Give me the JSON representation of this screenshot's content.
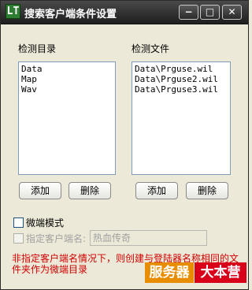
{
  "window": {
    "title": "搜索客户端条件设置",
    "icon_glyph": "LT",
    "minimize_glyph": "−",
    "maximize_glyph": "□",
    "close_glyph": "✕"
  },
  "dirs": {
    "label": "检测目录",
    "items": [
      "Data",
      "Map",
      "Wav"
    ],
    "add_label": "添加",
    "delete_label": "删除"
  },
  "files": {
    "label": "检测文件",
    "items": [
      "Data\\Prguse.wil",
      "Data\\Prguse2.wil",
      "Data\\Prguse3.wil"
    ],
    "add_label": "添加",
    "delete_label": "删除"
  },
  "options": {
    "micro_mode_label": "微端模式",
    "client_name_label": "指定客户端名:",
    "client_name_value": "热血传奇"
  },
  "warning_text": "非指定客户端名情况下，则创建与登陆器名称相同的文件夹作为微端目录",
  "watermark": {
    "left": "服务器",
    "right": "大本营"
  }
}
